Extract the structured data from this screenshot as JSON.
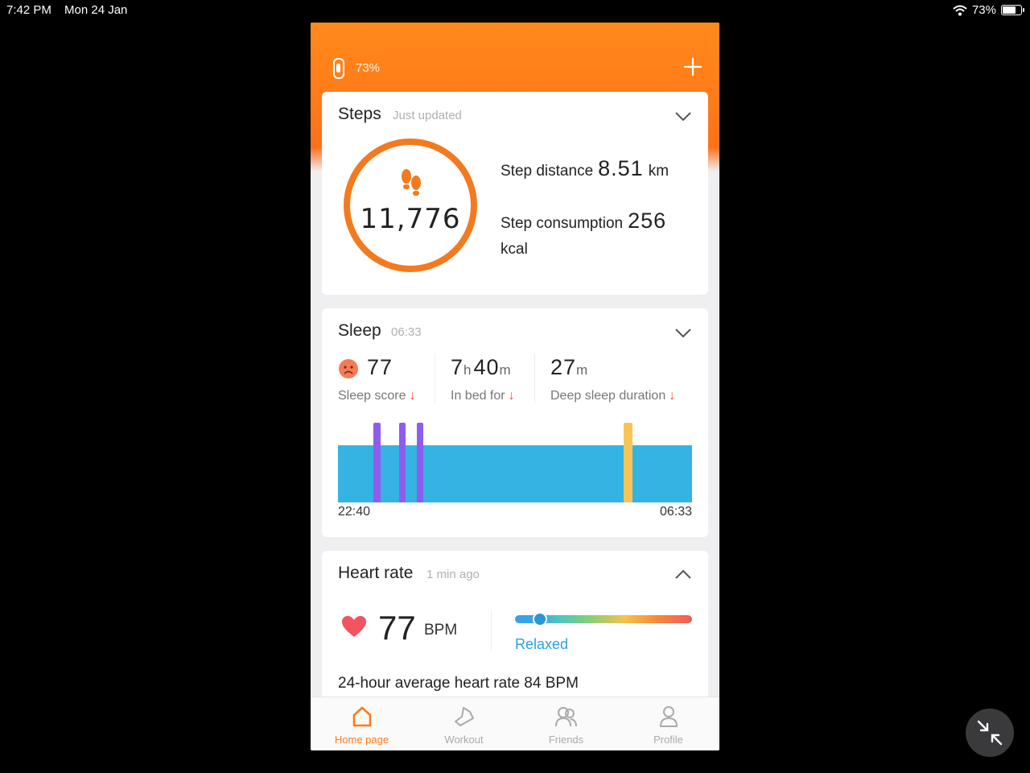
{
  "status_bar": {
    "time": "7:42 PM",
    "date": "Mon 24 Jan",
    "battery": "73%"
  },
  "header": {
    "band_battery": "73%"
  },
  "steps": {
    "title": "Steps",
    "subtitle": "Just updated",
    "count": "11,776",
    "distance_label": "Step distance",
    "distance_value": "8.51",
    "distance_unit": "km",
    "consumption_label": "Step consumption",
    "consumption_value": "256",
    "consumption_unit": "kcal"
  },
  "sleep": {
    "title": "Sleep",
    "subtitle": "06:33",
    "score_value": "77",
    "score_label": "Sleep score",
    "bed_hours": "7",
    "bed_hours_unit": "h",
    "bed_minutes": "40",
    "bed_minutes_unit": "m",
    "bed_label": "In bed for",
    "deep_value": "27",
    "deep_unit": "m",
    "deep_label": "Deep sleep duration",
    "start_time": "22:40",
    "end_time": "06:33"
  },
  "heart_rate": {
    "title": "Heart rate",
    "subtitle": "1 min ago",
    "value": "77",
    "unit": "BPM",
    "status": "Relaxed",
    "average": "24-hour average heart rate 84 BPM"
  },
  "nav": {
    "items": [
      {
        "label": "Home page",
        "icon": "home-icon"
      },
      {
        "label": "Workout",
        "icon": "shoe-icon"
      },
      {
        "label": "Friends",
        "icon": "friends-icon"
      },
      {
        "label": "Profile",
        "icon": "profile-icon"
      }
    ]
  },
  "colors": {
    "accent": "#ff7a18",
    "sleep_light": "#35b3e2",
    "sleep_rem": "#8e5df0",
    "sleep_awake": "#f7c557",
    "heart": "#f25460",
    "relaxed": "#2aa0dc"
  }
}
